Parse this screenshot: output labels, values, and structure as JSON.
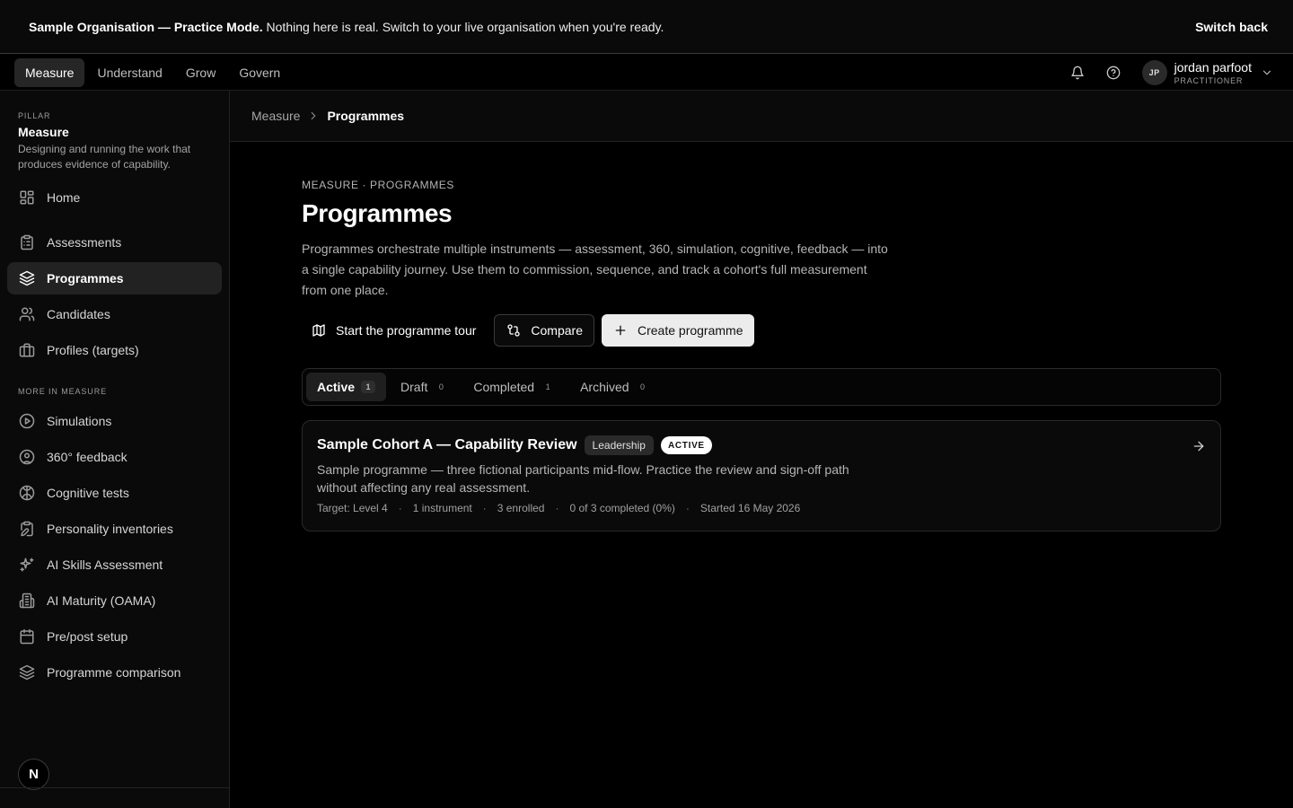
{
  "banner": {
    "title": "Sample Organisation — Practice Mode.",
    "message": "Nothing here is real. Switch to your live organisation when you're ready.",
    "switch_label": "Switch back"
  },
  "topnav": {
    "tabs": [
      {
        "label": "Measure",
        "active": true
      },
      {
        "label": "Understand"
      },
      {
        "label": "Grow"
      },
      {
        "label": "Govern"
      }
    ],
    "user": {
      "initials": "JP",
      "name": "jordan parfoot",
      "role": "PRACTITIONER"
    }
  },
  "sidebar": {
    "pillar_kicker": "PILLAR",
    "pillar_title": "Measure",
    "pillar_desc": "Designing and running the work that produces evidence of capability.",
    "items": [
      {
        "label": "Home",
        "icon": "grid-icon"
      },
      {
        "label": "Assessments",
        "icon": "clipboard-icon"
      },
      {
        "label": "Programmes",
        "icon": "layers-icon",
        "active": true
      },
      {
        "label": "Candidates",
        "icon": "users-icon"
      },
      {
        "label": "Profiles (targets)",
        "icon": "briefcase-icon"
      }
    ],
    "more_label": "MORE IN MEASURE",
    "more_items": [
      {
        "label": "Simulations",
        "icon": "play-circle-icon"
      },
      {
        "label": "360° feedback",
        "icon": "user-circle-icon"
      },
      {
        "label": "Cognitive tests",
        "icon": "brain-icon"
      },
      {
        "label": "Personality inventories",
        "icon": "clipboard-pen-icon"
      },
      {
        "label": "AI Skills Assessment",
        "icon": "sparkles-icon"
      },
      {
        "label": "AI Maturity (OAMA)",
        "icon": "building-icon"
      },
      {
        "label": "Pre/post setup",
        "icon": "calendar-icon"
      },
      {
        "label": "Programme comparison",
        "icon": "layers-icon"
      }
    ],
    "logo_letter": "N"
  },
  "breadcrumb": {
    "parent": "Measure",
    "current": "Programmes"
  },
  "page": {
    "kicker": "MEASURE · PROGRAMMES",
    "title": "Programmes",
    "description": "Programmes orchestrate multiple instruments — assessment, 360, simulation, cognitive, feedback — into a single capability journey. Use them to commission, sequence, and track a cohort's full measurement from one place.",
    "actions": {
      "tour": "Start the programme tour",
      "compare": "Compare",
      "create": "Create programme"
    },
    "tabs": [
      {
        "label": "Active",
        "count": "1",
        "active": true
      },
      {
        "label": "Draft",
        "count": "0"
      },
      {
        "label": "Completed",
        "count": "1"
      },
      {
        "label": "Archived",
        "count": "0"
      }
    ],
    "programme": {
      "title": "Sample Cohort A — Capability Review",
      "tag": "Leadership",
      "status": "ACTIVE",
      "description": "Sample programme — three fictional participants mid-flow. Practice the review and sign-off path without affecting any real assessment.",
      "meta": [
        "Target: Level 4",
        "1 instrument",
        "3 enrolled",
        "0 of 3 completed (0%)",
        "Started 16 May 2026"
      ]
    }
  }
}
